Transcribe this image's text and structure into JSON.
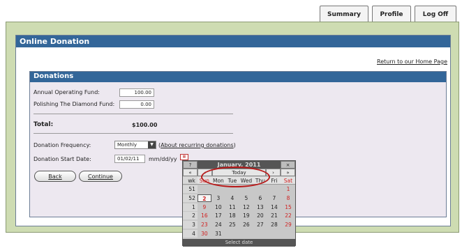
{
  "tabs": [
    {
      "label": "Summary"
    },
    {
      "label": "Profile"
    },
    {
      "label": "Log Off"
    }
  ],
  "online_donation": {
    "title": "Online Donation",
    "return_link": "Return to our Home Page"
  },
  "donations": {
    "title": "Donations",
    "funds": [
      {
        "label": "Annual Operating Fund:",
        "value": "100.00"
      },
      {
        "label": "Polishing The Diamond Fund:",
        "value": "0.00"
      }
    ],
    "total_label": "Total:",
    "total_value": "$100.00",
    "frequency_label": "Donation Frequency:",
    "frequency_value": "Monthly",
    "about_link": "About recurring donations",
    "about_prefix": "(",
    "about_suffix": ")",
    "start_label": "Donation Start Date:",
    "start_value": "01/02/11",
    "start_format": "mm/dd/yy",
    "back_label": "Back",
    "continue_label": "Continue"
  },
  "calendar": {
    "help": "?",
    "title": "January, 2011",
    "close": "×",
    "prev_year": "«",
    "prev_month": "‹",
    "today": "Today",
    "next_month": "›",
    "next_year": "»",
    "headers": [
      "wk",
      "Sun",
      "Mon",
      "Tue",
      "Wed",
      "Thu",
      "Fri",
      "Sat"
    ],
    "weeks": [
      {
        "wk": "51",
        "days": [
          "",
          "",
          "",
          "",
          "",
          "",
          "1"
        ]
      },
      {
        "wk": "52",
        "days": [
          "2",
          "3",
          "4",
          "5",
          "6",
          "7",
          "8"
        ]
      },
      {
        "wk": "1",
        "days": [
          "9",
          "10",
          "11",
          "12",
          "13",
          "14",
          "15"
        ]
      },
      {
        "wk": "2",
        "days": [
          "16",
          "17",
          "18",
          "19",
          "20",
          "21",
          "22"
        ]
      },
      {
        "wk": "3",
        "days": [
          "23",
          "24",
          "25",
          "26",
          "27",
          "28",
          "29"
        ]
      },
      {
        "wk": "4",
        "days": [
          "30",
          "31",
          "",
          "",
          "",
          "",
          ""
        ]
      }
    ],
    "footer": "Select date",
    "selected_day": "2"
  },
  "colors": {
    "header_blue": "#336699",
    "frame_green": "#cedcb2",
    "panel_lavender": "#ede8f0",
    "weekend_red": "#d02020",
    "annotation_red": "#b81a1a"
  }
}
